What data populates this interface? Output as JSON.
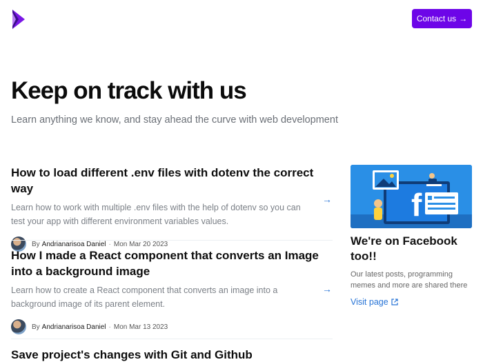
{
  "header": {
    "contact_label": "Contact us",
    "contact_arrow": "→"
  },
  "hero": {
    "title": "Keep on track with us",
    "subtitle": "Learn anything we know, and stay ahead the curve with web development"
  },
  "posts": [
    {
      "title": "How to load different .env files with dotenv the correct way",
      "excerpt": "Learn how to work with multiple .env files with the help of dotenv so you can test your app with different environment variables values.",
      "by": "By",
      "author": "Andrianarisoa Daniel",
      "dot": "·",
      "date": "Mon Mar 20 2023",
      "arrow": "→"
    },
    {
      "title": "How I made a React component that converts an Image into a background image",
      "excerpt": "Learn how to create a React component that converts an image into a background image of its parent element.",
      "by": "By",
      "author": "Andrianarisoa Daniel",
      "dot": "·",
      "date": "Mon Mar 13 2023",
      "arrow": "→"
    },
    {
      "title": "Save project's changes with Git and Github"
    }
  ],
  "facebook": {
    "title": "We're on Facebook too!!",
    "description": "Our latest posts, programming memes and more are shared there",
    "link_label": "Visit page",
    "link_icon": "external-link-icon",
    "brand_letter": "f"
  },
  "colors": {
    "accent": "#6d05e8",
    "link": "#2673d6",
    "facebook_bg": "#2a8fe6"
  }
}
